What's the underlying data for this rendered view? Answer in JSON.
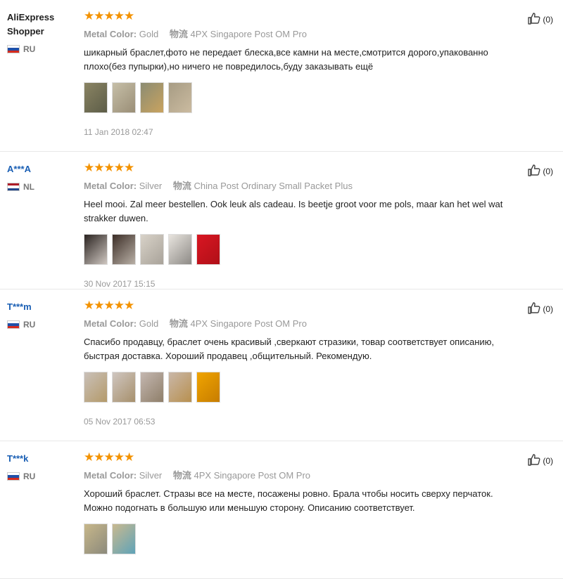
{
  "reviews": [
    {
      "user": "AliExpress Shopper",
      "user_line1": "AliExpress",
      "user_line2": "Shopper",
      "country": "RU",
      "flag": [
        "#ffffff",
        "#1f4fa8",
        "#d52b1e"
      ],
      "rating": 5,
      "color_label": "Metal Color:",
      "color_value": "Gold",
      "shipping_label": "物流",
      "shipping_value": "4PX Singapore Post OM Pro",
      "comment": "шикарный браслет,фото не передает блеска,все камни на месте,смотрится дорого,упакованно плохо(без пупырки),но ничего не повредилось,буду заказывать ещё",
      "photos": [
        [
          "#8a8463",
          "#5d5d48"
        ],
        [
          "#c6bfa8",
          "#9a8e76"
        ],
        [
          "#8b8c73",
          "#c9a35f"
        ],
        [
          "#a79c84",
          "#cbbba0"
        ]
      ],
      "date": "11 Jan 2018 02:47",
      "helpful_count": "(0)"
    },
    {
      "user": "A***A",
      "country": "NL",
      "flag": [
        "#ae1c28",
        "#ffffff",
        "#21468b"
      ],
      "rating": 5,
      "color_label": "Metal Color:",
      "color_value": "Silver",
      "shipping_label": "物流",
      "shipping_value": "China Post Ordinary Small Packet Plus",
      "comment": "Heel mooi. Zal meer bestellen. Ook leuk als cadeau. Is beetje groot voor me pols, maar kan het wel wat strakker duwen.",
      "photos": [
        [
          "#2a2320",
          "#cfc7c1"
        ],
        [
          "#3c2e27",
          "#b9b0a6"
        ],
        [
          "#d8d2c8",
          "#a9a39a"
        ],
        [
          "#e8e4de",
          "#8d8a86"
        ],
        [
          "#d91622",
          "#b01018"
        ]
      ],
      "date": "30 Nov 2017 15:15",
      "helpful_count": "(0)"
    },
    {
      "user": "T***m",
      "country": "RU",
      "flag": [
        "#ffffff",
        "#1f4fa8",
        "#d52b1e"
      ],
      "rating": 5,
      "color_label": "Metal Color:",
      "color_value": "Gold",
      "shipping_label": "物流",
      "shipping_value": "4PX Singapore Post OM Pro",
      "comment": "Спасибо продавцу, браслет очень красивый ,сверкают стразики, товар соответствует описанию, быстрая доставка. Хороший продавец ,общительный. Рекомендую.",
      "photos": [
        [
          "#c9c0b8",
          "#b49a6a"
        ],
        [
          "#cfc6c0",
          "#a7906c"
        ],
        [
          "#c4b7b0",
          "#8f7f6a"
        ],
        [
          "#c9b7a8",
          "#b8904f"
        ],
        [
          "#f0a400",
          "#c77d00"
        ]
      ],
      "date": "05 Nov 2017 06:53",
      "helpful_count": "(0)"
    },
    {
      "user": "T***k",
      "country": "RU",
      "flag": [
        "#ffffff",
        "#1f4fa8",
        "#d52b1e"
      ],
      "rating": 5,
      "color_label": "Metal Color:",
      "color_value": "Silver",
      "shipping_label": "物流",
      "shipping_value": "4PX Singapore Post OM Pro",
      "comment": "Хороший браслет. Стразы все на месте, посажены ровно. Брала чтобы носить сверху перчаток. Можно подогнать в большую или меньшую сторону. Описанию соответствует.",
      "photos": [
        [
          "#c7b78a",
          "#8c8a7c"
        ],
        [
          "#c9b98f",
          "#5fa3b8"
        ]
      ],
      "date": "",
      "helpful_count": "(0)"
    }
  ]
}
